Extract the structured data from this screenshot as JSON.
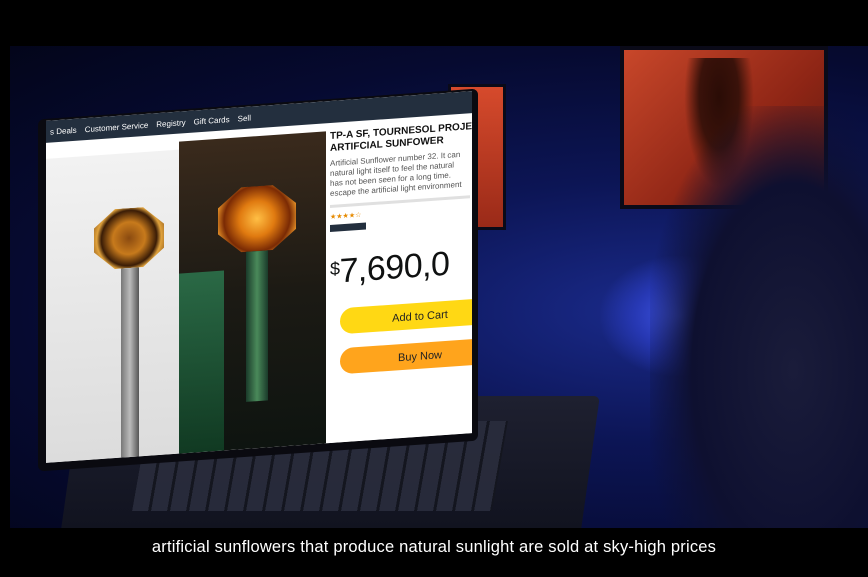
{
  "store": {
    "nav_items": [
      "s Deals",
      "Customer Service",
      "Registry",
      "Gift Cards",
      "Sell"
    ]
  },
  "product": {
    "title_line1": "TP-A SF, TOURNESOL PROJECT",
    "title_line2": "ARTIFCIAL SUNFOWER",
    "desc_line1": "Artificial Sunflower number 32. It can",
    "desc_line2": "natural light itself to feel the natural",
    "desc_line3": "has not been seen for a long time.",
    "desc_line4": "escape the artificial light environment",
    "price_currency": "$",
    "price_value": "7,690,0",
    "add_to_cart_label": "Add to Cart",
    "buy_now_label": "Buy Now"
  },
  "caption": {
    "text": "artificial sunflowers that produce natural sunlight are sold at sky-high prices"
  },
  "colors": {
    "scene_blue": "#0c1555",
    "cart_button": "#ffd814",
    "buy_button": "#ffa41c",
    "nav_bar": "#232f3e"
  }
}
